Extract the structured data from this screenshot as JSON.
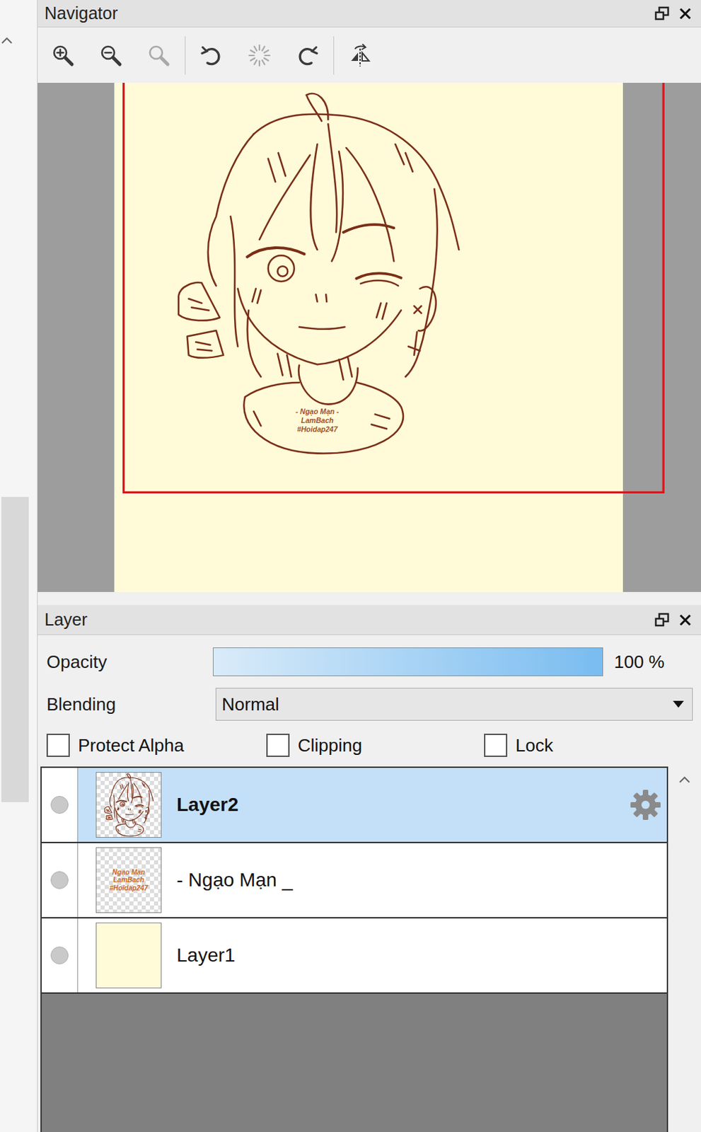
{
  "navigator": {
    "title": "Navigator",
    "tool_groups": [
      [
        {
          "kind": "zoom-in",
          "disabled": false
        },
        {
          "kind": "zoom-out",
          "disabled": false
        },
        {
          "kind": "zoom-reset",
          "disabled": true
        }
      ],
      [
        {
          "kind": "rotate-left",
          "disabled": false
        },
        {
          "kind": "rotate-reset",
          "disabled": true
        },
        {
          "kind": "rotate-right",
          "disabled": false
        }
      ],
      [
        {
          "kind": "flip",
          "disabled": false
        }
      ]
    ],
    "canvas": {
      "watermark": [
        "- Ngạo Mạn -",
        "LamBach",
        "#Hoidap247"
      ]
    }
  },
  "layer_panel": {
    "title": "Layer",
    "opacity": {
      "label": "Opacity",
      "level": 1,
      "reading": "100 %"
    },
    "blending": {
      "label": "Blending",
      "value": "Normal"
    },
    "options": [
      {
        "label": "Protect Alpha",
        "checked": false
      },
      {
        "label": "Clipping",
        "checked": false
      },
      {
        "label": "Lock",
        "checked": false
      }
    ],
    "layers": [
      {
        "name": "Layer2",
        "kind": "sketch",
        "selected": true,
        "has_settings": true
      },
      {
        "name": "- Ngạo Mạn _",
        "kind": "text",
        "selected": false,
        "has_settings": false,
        "thumb_text": [
          "Ngạo Mạn",
          "LamBach",
          "#Hoidap247"
        ]
      },
      {
        "name": "Layer1",
        "kind": "fill",
        "selected": false,
        "has_settings": false
      }
    ]
  }
}
